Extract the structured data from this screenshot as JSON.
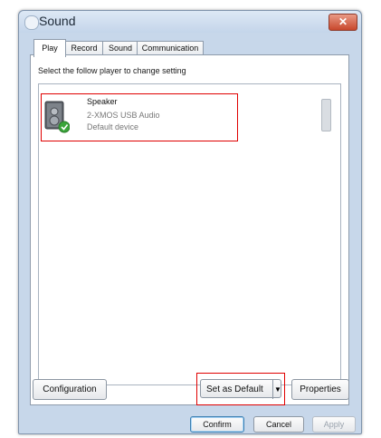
{
  "window": {
    "title": "Sound",
    "close_label": "✕"
  },
  "tabs": [
    {
      "label": "Play",
      "active": true
    },
    {
      "label": "Record",
      "active": false
    },
    {
      "label": "Sound",
      "active": false
    },
    {
      "label": "Communication",
      "active": false
    }
  ],
  "panel": {
    "instruction": "Select the follow player to change setting"
  },
  "devices": [
    {
      "name": "Speaker",
      "driver": "2-XMOS USB Audio",
      "status": "Default device",
      "icon": "speaker-icon",
      "selected": true
    }
  ],
  "actions": {
    "configuration_label": "Configuration",
    "set_default_label": "Set as Default",
    "set_default_arrow": "▼",
    "properties_label": "Properties"
  },
  "footer": {
    "confirm_label": "Confirm",
    "cancel_label": "Cancel",
    "apply_label": "Apply"
  },
  "colors": {
    "highlight": "#e00000",
    "check_badge": "#3aa53a"
  }
}
